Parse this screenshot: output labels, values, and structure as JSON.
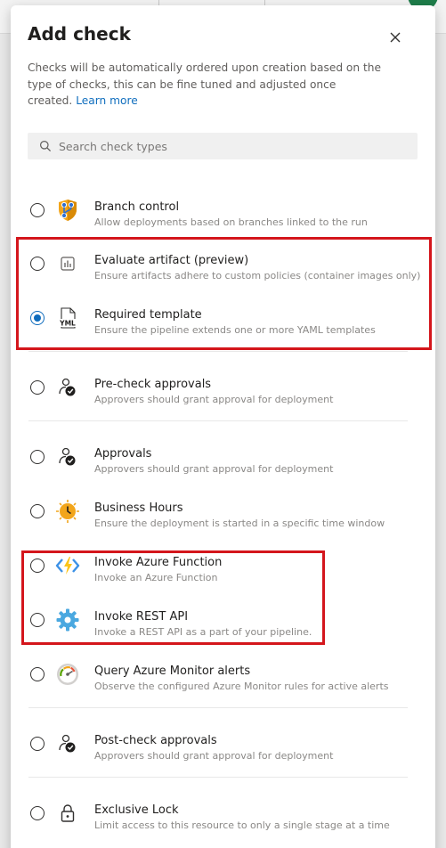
{
  "dialog": {
    "title": "Add check",
    "description": "Checks will be automatically ordered upon creation based on the type of checks, this can be fine tuned and adjusted once created.",
    "learn_more": "Learn more"
  },
  "search": {
    "placeholder": "Search check types"
  },
  "checks": [
    {
      "title": "Branch control",
      "description": "Allow deployments based on branches linked to the run",
      "icon": "shield-branch-icon",
      "selected": false
    },
    {
      "title": "Evaluate artifact (preview)",
      "description": "Ensure artifacts adhere to custom policies (container images only)",
      "icon": "artifact-chart-icon",
      "selected": false
    },
    {
      "title": "Required template",
      "description": "Ensure the pipeline extends one or more YAML templates",
      "icon": "yaml-file-icon",
      "icon_text": "YML",
      "selected": true
    },
    {
      "title": "Pre-check approvals",
      "description": "Approvers should grant approval for deployment",
      "icon": "person-check-icon",
      "selected": false
    },
    {
      "title": "Approvals",
      "description": "Approvers should grant approval for deployment",
      "icon": "person-check-icon",
      "selected": false
    },
    {
      "title": "Business Hours",
      "description": "Ensure the deployment is started in a specific time window",
      "icon": "clock-sun-icon",
      "selected": false
    },
    {
      "title": "Invoke Azure Function",
      "description": "Invoke an Azure Function",
      "icon": "azure-function-icon",
      "selected": false
    },
    {
      "title": "Invoke REST API",
      "description": "Invoke a REST API as a part of your pipeline.",
      "icon": "gear-icon",
      "selected": false
    },
    {
      "title": "Query Azure Monitor alerts",
      "description": "Observe the configured Azure Monitor rules for active alerts",
      "icon": "gauge-icon",
      "selected": false
    },
    {
      "title": "Post-check approvals",
      "description": "Approvers should grant approval for deployment",
      "icon": "person-check-icon",
      "selected": false
    },
    {
      "title": "Exclusive Lock",
      "description": "Limit access to this resource to only a single stage at a time",
      "icon": "lock-icon",
      "selected": false
    }
  ],
  "colors": {
    "accent": "#0f6cbd",
    "highlight": "#d4161c",
    "link": "#106ebe"
  }
}
